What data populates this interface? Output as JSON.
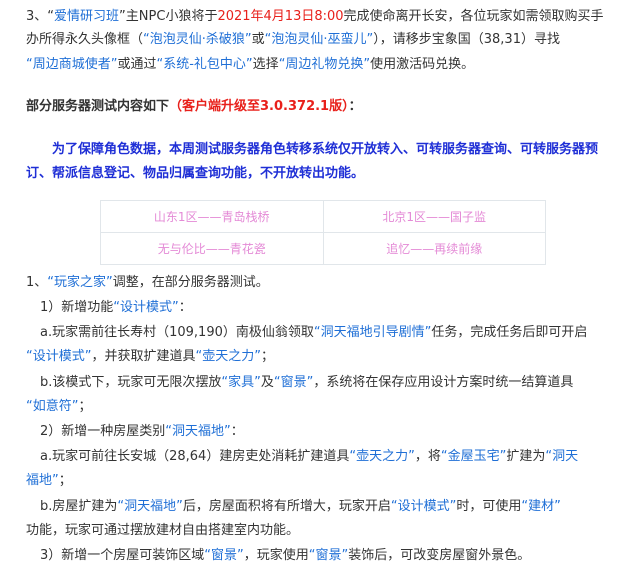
{
  "para3": {
    "num": "3、",
    "quote_open": "“",
    "event_name": "爱情研习班",
    "quote_close": "”",
    "t1": "主NPC小狼将于",
    "date": "2021年4月13日8:00",
    "t2": "完成使命离开长安，各位玩家如需领取购买手",
    "t3": "办所得永久头像框（",
    "frame1": "“泡泡灵仙·杀破狼”",
    "t4": "或",
    "frame2": "“泡泡灵仙·巫蛮儿”",
    "t5": "），请移步宝象国（38,31）寻找",
    "npc": "“周边商城使者”",
    "t6": "或通过",
    "system": "“系统-礼包中心”",
    "t7": "选择",
    "gift": "“周边礼物兑换”",
    "t8": "使用激活码兑换。"
  },
  "test_header": {
    "title": "部分服务器测试内容如下",
    "client": "（客户端升级至3.0.372.1版）",
    "colon": "："
  },
  "notice": {
    "line1": "为了保障角色数据，本周测试服务器角色转移系统仅开放转入、可转服务器查询、可转服务器预",
    "line2": "订、帮派信息登记、物品归属查询功能，不开放转出功能。"
  },
  "servers": [
    [
      "山东1区——青岛栈桥",
      "北京1区——国子监"
    ],
    [
      "无与伦比——青花瓷",
      "追忆——再续前缘"
    ]
  ],
  "item1": {
    "num": "1、",
    "name": "“玩家之家”",
    "t1": "调整，在部分服务器测试。"
  },
  "sub1": {
    "label": "1）新增功能",
    "mode": "“设计模式”",
    "colon": "："
  },
  "sub1a": {
    "t1": "a.玩家需前往长寿村（109,190）南极仙翁领取",
    "quest": "“洞天福地引导剧情”",
    "t2": "任务，完成任务后即可开启",
    "mode": "“设计模式”",
    "t3": "，并获取扩建道具",
    "tool": "“壶天之力”",
    "t4": "；"
  },
  "sub1b": {
    "t1": "b.该模式下，玩家可无限次摆放",
    "furniture": "“家具”",
    "t2": "及",
    "window": "“窗景”",
    "t3": "，系统将在保存应用设计方案时统一结算道具",
    "ruyi": "“如意符”",
    "t4": "；"
  },
  "sub2": {
    "label": "2）新增一种房屋类别",
    "type": "“洞天福地”",
    "colon": "："
  },
  "sub2a": {
    "t1": "a.玩家可前往长安城（28,64）建房吏处消耗扩建道具",
    "tool": "“壶天之力”",
    "t2": "，将",
    "house": "“金屋玉宅”",
    "t3": "扩建为",
    "dest1": "“洞天",
    "dest2": "福地”",
    "t4": "；"
  },
  "sub2b": {
    "t1": "b.房屋扩建为",
    "type": "“洞天福地”",
    "t2": "后，房屋面积将有所增大，玩家开启",
    "mode": "“设计模式”",
    "t3": "时，可使用",
    "material": "“建材”",
    "t4": "功能，玩家可通过摆放建材自由搭建室内功能。"
  },
  "sub3": {
    "t1": "3）新增一个房屋可装饰区域",
    "window": "“窗景”",
    "t2": "，玩家使用",
    "window2": "“窗景”",
    "t3": "装饰后，可改变房屋窗外景色。"
  }
}
